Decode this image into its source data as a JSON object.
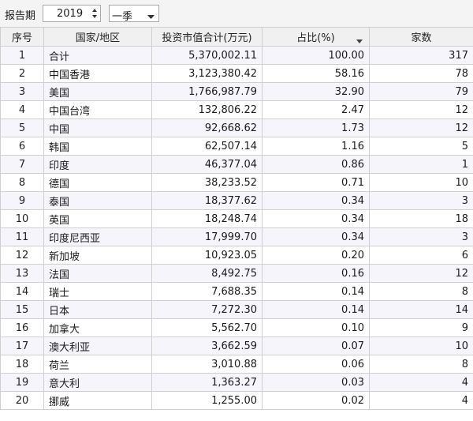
{
  "toolbar": {
    "period_label": "报告期",
    "year_value": "2019",
    "season_value": "一季"
  },
  "table": {
    "headers": {
      "no": "序号",
      "country": "国家/地区",
      "market_value": "投资市值合计(万元)",
      "ratio": "占比(%)",
      "count": "家数"
    },
    "rows": [
      {
        "no": "1",
        "country": "合计",
        "market_value": "5,370,002.11",
        "ratio": "100.00",
        "count": "317"
      },
      {
        "no": "2",
        "country": "中国香港",
        "market_value": "3,123,380.42",
        "ratio": "58.16",
        "count": "78"
      },
      {
        "no": "3",
        "country": "美国",
        "market_value": "1,766,987.79",
        "ratio": "32.90",
        "count": "79"
      },
      {
        "no": "4",
        "country": "中国台湾",
        "market_value": "132,806.22",
        "ratio": "2.47",
        "count": "12"
      },
      {
        "no": "5",
        "country": "中国",
        "market_value": "92,668.62",
        "ratio": "1.73",
        "count": "12"
      },
      {
        "no": "6",
        "country": "韩国",
        "market_value": "62,507.14",
        "ratio": "1.16",
        "count": "5"
      },
      {
        "no": "7",
        "country": "印度",
        "market_value": "46,377.04",
        "ratio": "0.86",
        "count": "1"
      },
      {
        "no": "8",
        "country": "德国",
        "market_value": "38,233.52",
        "ratio": "0.71",
        "count": "10"
      },
      {
        "no": "9",
        "country": "泰国",
        "market_value": "18,377.62",
        "ratio": "0.34",
        "count": "3"
      },
      {
        "no": "10",
        "country": "英国",
        "market_value": "18,248.74",
        "ratio": "0.34",
        "count": "18"
      },
      {
        "no": "11",
        "country": "印度尼西亚",
        "market_value": "17,999.70",
        "ratio": "0.34",
        "count": "3"
      },
      {
        "no": "12",
        "country": "新加坡",
        "market_value": "10,923.05",
        "ratio": "0.20",
        "count": "6"
      },
      {
        "no": "13",
        "country": "法国",
        "market_value": "8,492.75",
        "ratio": "0.16",
        "count": "12"
      },
      {
        "no": "14",
        "country": "瑞士",
        "market_value": "7,688.35",
        "ratio": "0.14",
        "count": "8"
      },
      {
        "no": "15",
        "country": "日本",
        "market_value": "7,272.30",
        "ratio": "0.14",
        "count": "14"
      },
      {
        "no": "16",
        "country": "加拿大",
        "market_value": "5,562.70",
        "ratio": "0.10",
        "count": "9"
      },
      {
        "no": "17",
        "country": "澳大利亚",
        "market_value": "3,662.59",
        "ratio": "0.07",
        "count": "10"
      },
      {
        "no": "18",
        "country": "荷兰",
        "market_value": "3,010.88",
        "ratio": "0.06",
        "count": "8"
      },
      {
        "no": "19",
        "country": "意大利",
        "market_value": "1,363.27",
        "ratio": "0.03",
        "count": "4"
      },
      {
        "no": "20",
        "country": "挪威",
        "market_value": "1,255.00",
        "ratio": "0.02",
        "count": "4"
      }
    ]
  },
  "icons": {
    "spin_up": "arrow-up-icon",
    "spin_down": "arrow-down-icon",
    "dropdown": "caret-down-icon",
    "sort": "sort-desc-icon"
  },
  "colors": {
    "odd_row_bg": "#f7f5fc",
    "header_bg": "#f0f0f0",
    "grid_line": "#cfcfcf"
  }
}
